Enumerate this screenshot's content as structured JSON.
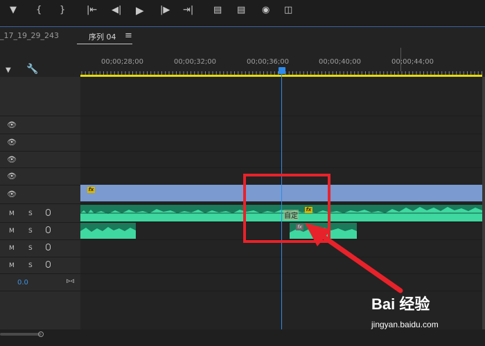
{
  "toolbar": {
    "icons": [
      "marker-icon",
      "in-point-icon",
      "out-point-icon",
      "go-to-in-icon",
      "step-back-icon",
      "play-icon",
      "step-forward-icon",
      "go-to-out-icon",
      "lift-icon",
      "extract-icon",
      "camera-icon",
      "compare-icon"
    ]
  },
  "tabs": {
    "project_tab": "_17_19_29_243",
    "sequence_tab": "序列 04",
    "menu_glyph": "≡"
  },
  "timeline": {
    "timecodes": [
      "00;00;28;00",
      "00;00;32;00",
      "00;00;36;00",
      "00;00;40;00",
      "00;00;44;00"
    ],
    "audio_track_buttons": {
      "mute": "M",
      "solo": "S"
    },
    "volume_value": "0.0",
    "clip_label_fragment": "自定",
    "fx_label": "fx"
  },
  "watermark": {
    "top": "Bai 经验",
    "bottom": "jingyan.baidu.com"
  },
  "colors": {
    "playhead": "#2d8ceb",
    "video_clip": "#7a9ad0",
    "audio_clip": "#1a7a5a",
    "annotation": "#e8222a",
    "work_area_bar": "#e8dc00"
  }
}
